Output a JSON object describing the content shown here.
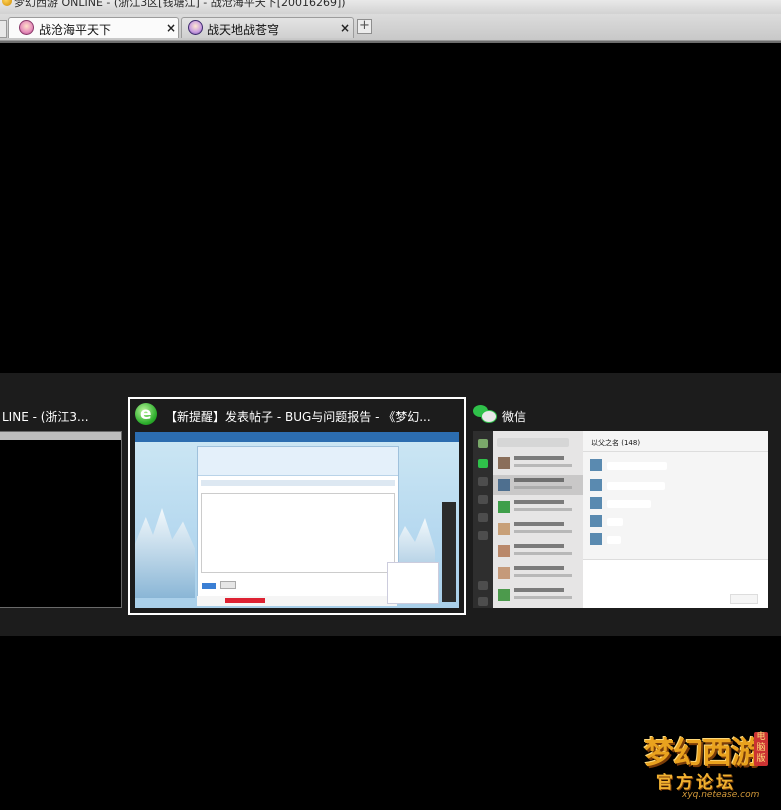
{
  "window": {
    "title": "梦幻西游 ONLINE - (浙江3区[钱塘江] - 战沧海平天下[20016269])"
  },
  "tabs": [
    {
      "label": "战沧海平天下",
      "active": true
    },
    {
      "label": "战天地战苍穹",
      "active": false
    }
  ],
  "tab_close_glyph": "×",
  "tab_add_glyph": "+",
  "switcher": {
    "windows": [
      {
        "title": "LINE - (浙江3...",
        "app": "梦幻西游 ONLINE",
        "selected": false
      },
      {
        "title": "【新提醒】发表帖子 - BUG与问题报告 - 《梦幻...",
        "app": "browser",
        "icon": "ie-icon",
        "selected": true
      },
      {
        "title": "微信",
        "app": "wechat",
        "icon": "wechat-icon",
        "selected": false
      }
    ],
    "wechat_preview": {
      "chat_title": "以父之名 (148)"
    }
  },
  "watermark": {
    "logo_text": "梦幻西游",
    "badge": "电脑版",
    "subtitle": "官方论坛",
    "url": "xyq.netease.com"
  },
  "colors": {
    "background": "#000000",
    "switcher_bg": "#1c1c1c",
    "selection_border": "#ffffff",
    "wechat_green": "#2fc14a"
  }
}
